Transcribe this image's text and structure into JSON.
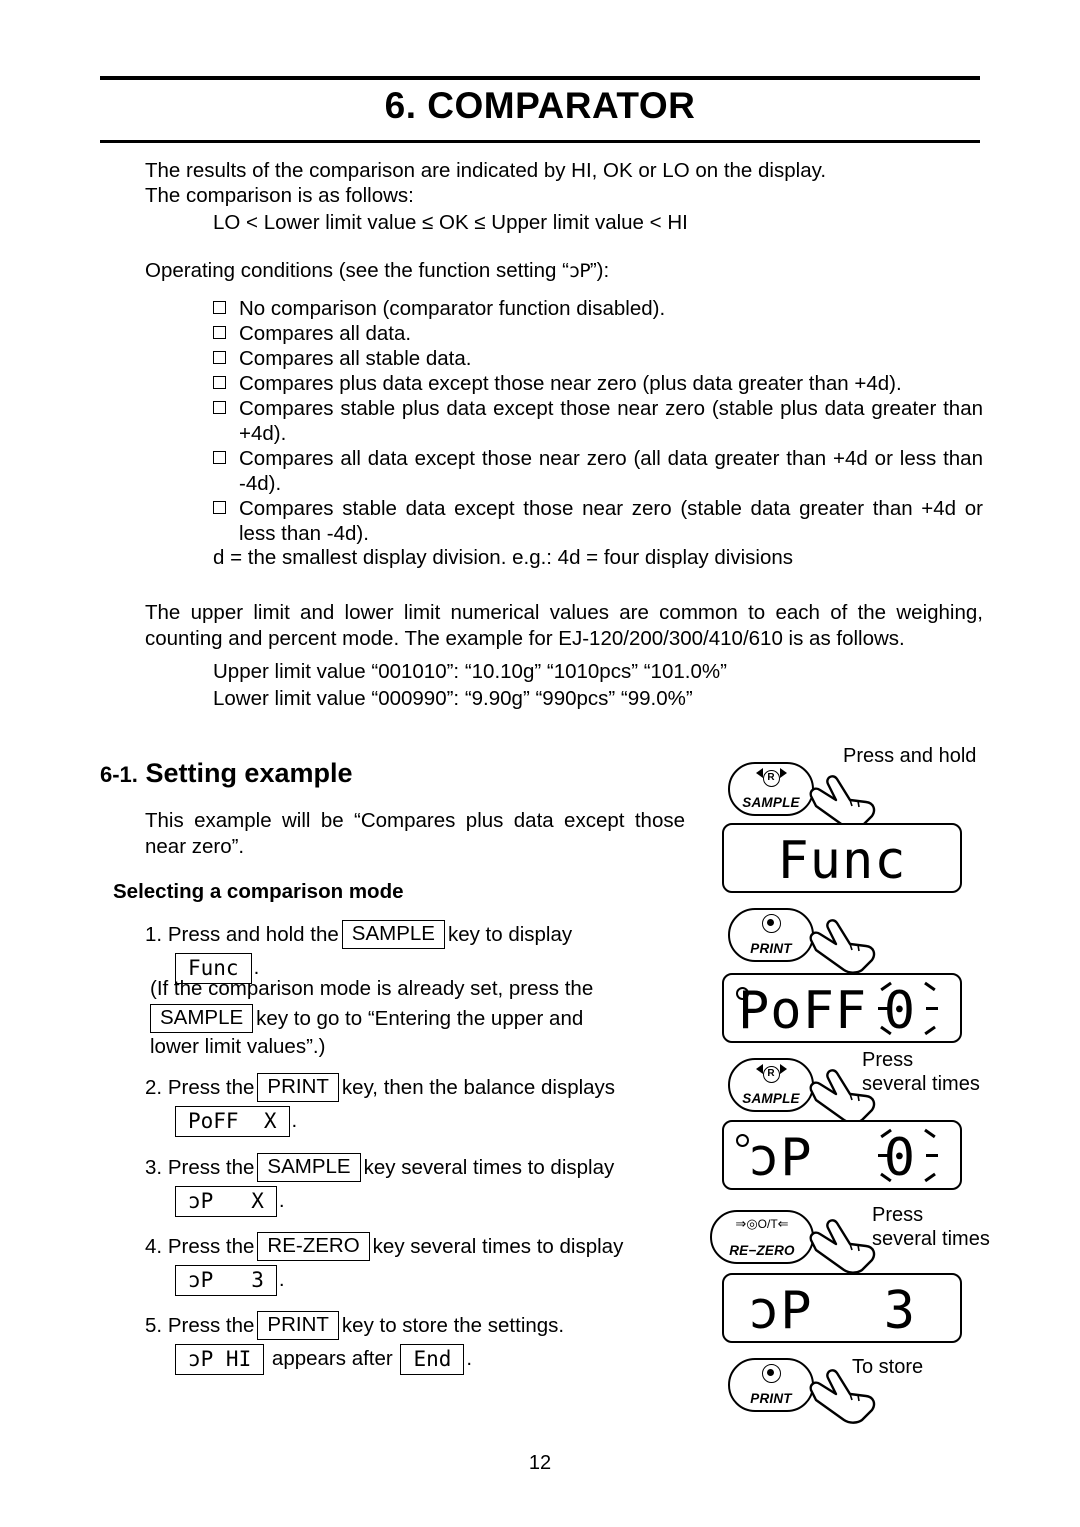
{
  "chapter": {
    "title": "6. COMPARATOR"
  },
  "intro": {
    "line1": "The results of the comparison are indicated by HI, OK or LO on the display.",
    "line2": "The comparison is as follows:",
    "line3": "LO < Lower limit value ≤ OK ≤ Upper limit value < HI",
    "op_conditions_pre": "Operating conditions (see the function setting “",
    "op_conditions_seg": "ɔP",
    "op_conditions_post": "”):"
  },
  "bullets": [
    "No comparison (comparator function disabled).",
    "Compares all data.",
    "Compares all stable data.",
    "Compares plus data except those near zero (plus data greater than +4d).",
    "Compares stable plus data except those near zero (stable plus data greater than +4d).",
    "Compares all data except those near zero (all data greater than +4d or less than -4d).",
    "Compares stable data except those near zero (stable data greater than +4d or less than -4d)."
  ],
  "d_note": "d = the smallest display division.    e.g.: 4d = four display divisions",
  "limits_paragraph": "The upper limit and lower limit numerical values are common to each of the weighing, counting and percent mode. The example for EJ-120/200/300/410/610 is as follows.",
  "limit_values": {
    "upper": "Upper limit value “001010”: “10.10g”  “1010pcs”  “101.0%”",
    "lower": "Lower limit value “000990”: “9.90g”   “990pcs”   “99.0%”"
  },
  "section": {
    "number": "6-1.",
    "title": "Setting example",
    "example_text": "This example will be “Compares plus data except those near zero”.",
    "sub_head": "Selecting a comparison mode"
  },
  "steps": {
    "s1": {
      "num": "1.",
      "pre": "Press and hold the",
      "key": "SAMPLE",
      "post": "key to display",
      "display": "Func",
      "tail": "."
    },
    "note": {
      "line1": "(If the comparison mode is already set, press the",
      "key": "SAMPLE",
      "line2": "key to go to “Entering the upper and",
      "line3": "lower limit values”.)"
    },
    "s2": {
      "num": "2.",
      "pre": "Press the",
      "key": "PRINT",
      "post": "key, then the balance displays",
      "display": "PoFF  X",
      "tail": "."
    },
    "s3": {
      "num": "3.",
      "pre": "Press the",
      "key": "SAMPLE",
      "post": "key several times to display",
      "display": "ɔP   X",
      "tail": "."
    },
    "s4": {
      "num": "4.",
      "pre": "Press the",
      "key": "RE-ZERO",
      "post": "key several times to display",
      "display": "ɔP   3",
      "tail": "."
    },
    "s5": {
      "num": "5.",
      "pre": "Press the",
      "key": "PRINT",
      "post": "key to store the settings.",
      "display1": "ɔP HI",
      "mid": "appears after",
      "display2": "End",
      "tail": "."
    }
  },
  "right_panel": {
    "note_hold": "Press and hold",
    "note_press1_l1": "Press",
    "note_press1_l2": "several times",
    "note_press2_l1": "Press",
    "note_press2_l2": "several times",
    "note_store": "To store",
    "displays": {
      "func": "Func",
      "poff": "PoFF",
      "poff_val": "0",
      "cp": "ɔP",
      "cp_val": "0",
      "cp3": "ɔP",
      "cp3_val": "3"
    },
    "keys": {
      "sample": "SAMPLE",
      "print": "PRINT",
      "rezero": "RE−ZERO",
      "rezero_glyph": "O/T"
    }
  },
  "page_number": "12"
}
